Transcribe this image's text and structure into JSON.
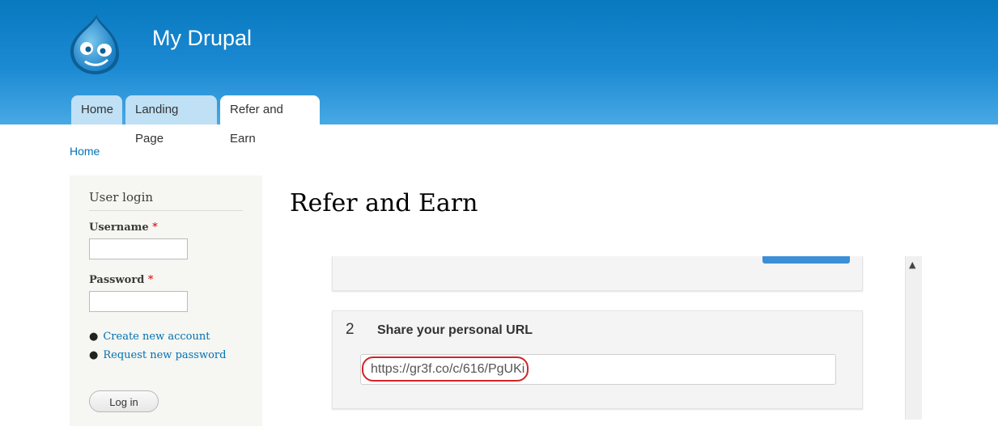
{
  "site": {
    "name": "My Drupal"
  },
  "tabs": [
    {
      "label": "Home"
    },
    {
      "label": "Landing Page"
    },
    {
      "label": "Refer and Earn"
    }
  ],
  "breadcrumb": {
    "home": "Home"
  },
  "login": {
    "title": "User login",
    "username_label": "Username",
    "password_label": "Password",
    "required_mark": "*",
    "links": [
      "Create new account",
      "Request new password"
    ],
    "button": "Log in"
  },
  "main": {
    "title": "Refer and Earn",
    "step_number": "2",
    "step_title": "Share your personal URL",
    "url": "https://gr3f.co/c/616/PgUKi"
  },
  "colors": {
    "header_blue": "#0779bf",
    "link": "#0071b3",
    "highlight": "#d2232a"
  },
  "icons": {
    "scroll_up": "chevron-up-icon",
    "logo": "drupal-drop-logo"
  }
}
